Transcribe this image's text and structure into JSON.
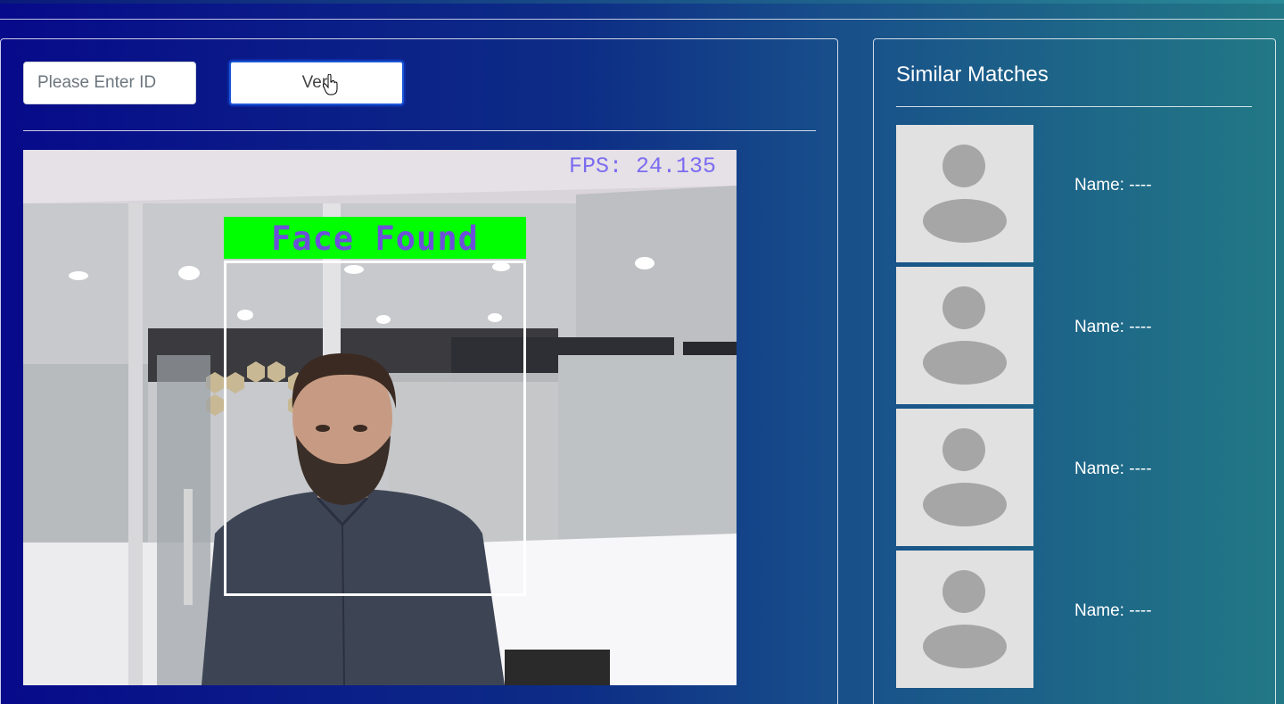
{
  "form": {
    "id_placeholder": "Please Enter ID",
    "id_value": "",
    "verify_label": "Veri"
  },
  "video": {
    "fps_text": "FPS: 24.135",
    "face_label": "Face Found",
    "label_color": "#00ff00",
    "box_color": "#ffffff"
  },
  "matches": {
    "title": "Similar Matches",
    "items": [
      {
        "name": "Name: ----",
        "avatar_icon": "user-placeholder-icon"
      },
      {
        "name": "Name: ----",
        "avatar_icon": "user-placeholder-icon"
      },
      {
        "name": "Name: ----",
        "avatar_icon": "user-placeholder-icon"
      },
      {
        "name": "Name: ----",
        "avatar_icon": "user-placeholder-icon"
      }
    ]
  },
  "colors": {
    "background_start": "#070a8a",
    "background_end": "#227986",
    "button_border": "#1a57d6",
    "avatar_bg": "#e1e1e1",
    "avatar_fg": "#a6a6a6"
  }
}
